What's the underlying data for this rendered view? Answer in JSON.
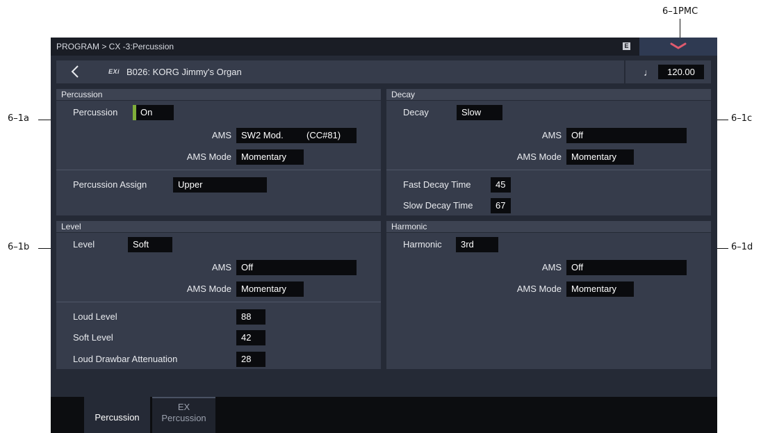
{
  "callouts": {
    "pmc": "6–1PMC",
    "a": "6–1a",
    "b": "6–1b",
    "c": "6–1c",
    "d": "6–1d"
  },
  "header": {
    "breadcrumb": "PROGRAM > CX -3:Percussion",
    "menu_badge": "E"
  },
  "program": {
    "bank_badge": "EXi",
    "name": "B026: KORG Jimmy's Organ",
    "tempo": "120.00"
  },
  "percussion_section": {
    "header": "Percussion",
    "percussion_label": "Percussion",
    "percussion_value": "On",
    "ams_label": "AMS",
    "ams_value": "SW2 Mod.",
    "ams_cc": "(CC#81)",
    "ams_mode_label": "AMS Mode",
    "ams_mode_value": "Momentary",
    "assign_label": "Percussion Assign",
    "assign_value": "Upper"
  },
  "decay_section": {
    "header": "Decay",
    "decay_label": "Decay",
    "decay_value": "Slow",
    "ams_label": "AMS",
    "ams_value": "Off",
    "ams_mode_label": "AMS Mode",
    "ams_mode_value": "Momentary",
    "fast_label": "Fast Decay Time",
    "fast_value": "45",
    "slow_label": "Slow Decay Time",
    "slow_value": "67"
  },
  "level_section": {
    "header": "Level",
    "level_label": "Level",
    "level_value": "Soft",
    "ams_label": "AMS",
    "ams_value": "Off",
    "ams_mode_label": "AMS Mode",
    "ams_mode_value": "Momentary",
    "loud_label": "Loud Level",
    "loud_value": "88",
    "soft_label": "Soft Level",
    "soft_value": "42",
    "atten_label": "Loud Drawbar Attenuation",
    "atten_value": "28"
  },
  "harmonic_section": {
    "header": "Harmonic",
    "harmonic_label": "Harmonic",
    "harmonic_value": "3rd",
    "ams_label": "AMS",
    "ams_value": "Off",
    "ams_mode_label": "AMS Mode",
    "ams_mode_value": "Momentary"
  },
  "tabs": {
    "percussion": "Percussion",
    "ex_line1": "EX",
    "ex_line2": "Percussion"
  }
}
